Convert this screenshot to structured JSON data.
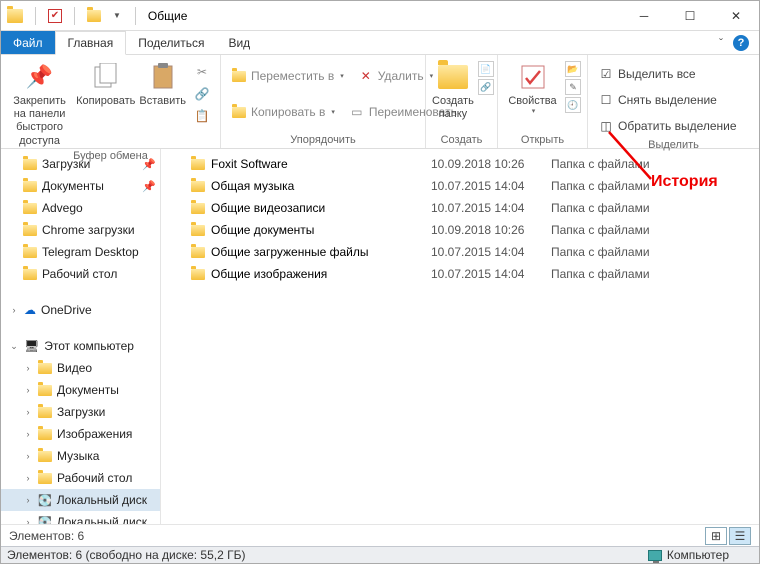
{
  "window": {
    "title": "Общие"
  },
  "menu": {
    "file": "Файл",
    "home": "Главная",
    "share": "Поделиться",
    "view": "Вид"
  },
  "ribbon": {
    "clipboard": {
      "pin": "Закрепить на панели\nбыстрого доступа",
      "copy": "Копировать",
      "paste": "Вставить",
      "label": "Буфер обмена"
    },
    "organize": {
      "move": "Переместить в",
      "copyto": "Копировать в",
      "delete": "Удалить",
      "rename": "Переименовать",
      "label": "Упорядочить"
    },
    "new": {
      "newfolder": "Создать\nпапку",
      "label": "Создать"
    },
    "open": {
      "properties": "Свойства",
      "label": "Открыть"
    },
    "select": {
      "all": "Выделить все",
      "none": "Снять выделение",
      "invert": "Обратить выделение",
      "label": "Выделить"
    }
  },
  "sidebar": {
    "items": [
      {
        "label": "Загрузки",
        "pinned": true
      },
      {
        "label": "Документы",
        "pinned": true
      },
      {
        "label": "Advego",
        "pinned": false
      },
      {
        "label": "Chrome загрузки",
        "pinned": false
      },
      {
        "label": "Telegram Desktop",
        "pinned": false
      },
      {
        "label": "Рабочий стол",
        "pinned": false
      }
    ],
    "onedrive": "OneDrive",
    "thispc": "Этот компьютер",
    "pcitems": [
      {
        "label": "Видео"
      },
      {
        "label": "Документы"
      },
      {
        "label": "Загрузки"
      },
      {
        "label": "Изображения"
      },
      {
        "label": "Музыка"
      },
      {
        "label": "Рабочий стол"
      },
      {
        "label": "Локальный диск"
      },
      {
        "label": "Локальный диск"
      }
    ]
  },
  "files": [
    {
      "name": "Foxit Software",
      "date": "10.09.2018 10:26",
      "type": "Папка с файлами"
    },
    {
      "name": "Общая музыка",
      "date": "10.07.2015 14:04",
      "type": "Папка с файлами"
    },
    {
      "name": "Общие видеозаписи",
      "date": "10.07.2015 14:04",
      "type": "Папка с файлами"
    },
    {
      "name": "Общие документы",
      "date": "10.09.2018 10:26",
      "type": "Папка с файлами"
    },
    {
      "name": "Общие загруженные файлы",
      "date": "10.07.2015 14:04",
      "type": "Папка с файлами"
    },
    {
      "name": "Общие изображения",
      "date": "10.07.2015 14:04",
      "type": "Папка с файлами"
    }
  ],
  "status": {
    "count": "Элементов: 6"
  },
  "bottom": {
    "info": "Элементов: 6 (свободно на диске: 55,2 ГБ)",
    "computer": "Компьютер"
  },
  "annotation": {
    "label": "История"
  }
}
